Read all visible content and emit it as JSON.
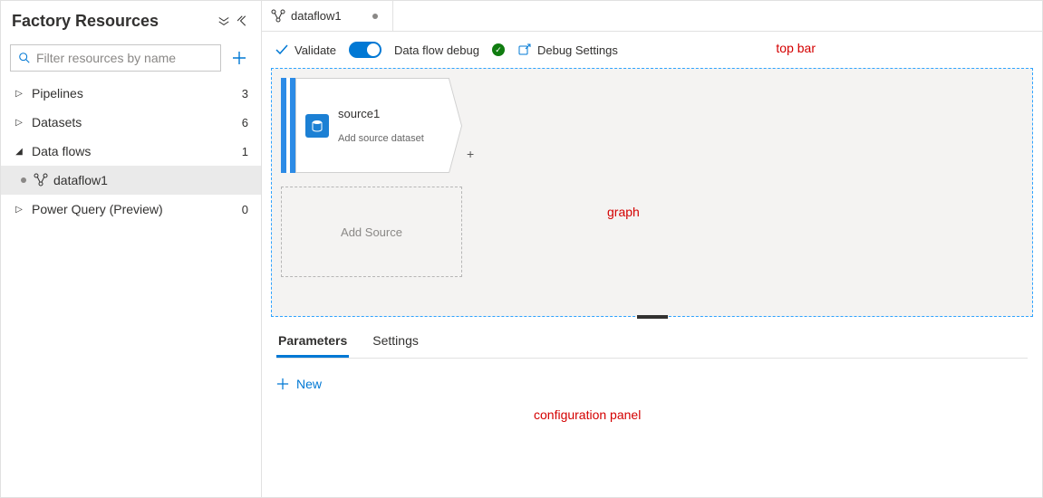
{
  "sidebar": {
    "title": "Factory Resources",
    "search_placeholder": "Filter resources by name",
    "items": [
      {
        "label": "Pipelines",
        "count": "3",
        "expanded": false
      },
      {
        "label": "Datasets",
        "count": "6",
        "expanded": false
      },
      {
        "label": "Data flows",
        "count": "1",
        "expanded": true,
        "children": [
          {
            "label": "dataflow1",
            "active": true,
            "dirty": true
          }
        ]
      },
      {
        "label": "Power Query (Preview)",
        "count": "0",
        "expanded": false
      }
    ]
  },
  "tab": {
    "title": "dataflow1"
  },
  "toolbar": {
    "validate": "Validate",
    "debug_label": "Data flow debug",
    "debug_settings": "Debug Settings"
  },
  "annotations": {
    "topbar": "top bar",
    "graph": "graph",
    "config": "configuration panel"
  },
  "graph": {
    "source_node": {
      "name": "source1",
      "subtitle": "Add source dataset"
    },
    "add_source": "Add Source"
  },
  "config": {
    "tabs": [
      {
        "label": "Parameters",
        "active": true
      },
      {
        "label": "Settings",
        "active": false
      }
    ],
    "new_label": "New"
  },
  "colors": {
    "accent": "#0078d4",
    "annotation": "#d40000",
    "ok": "#107c10"
  }
}
